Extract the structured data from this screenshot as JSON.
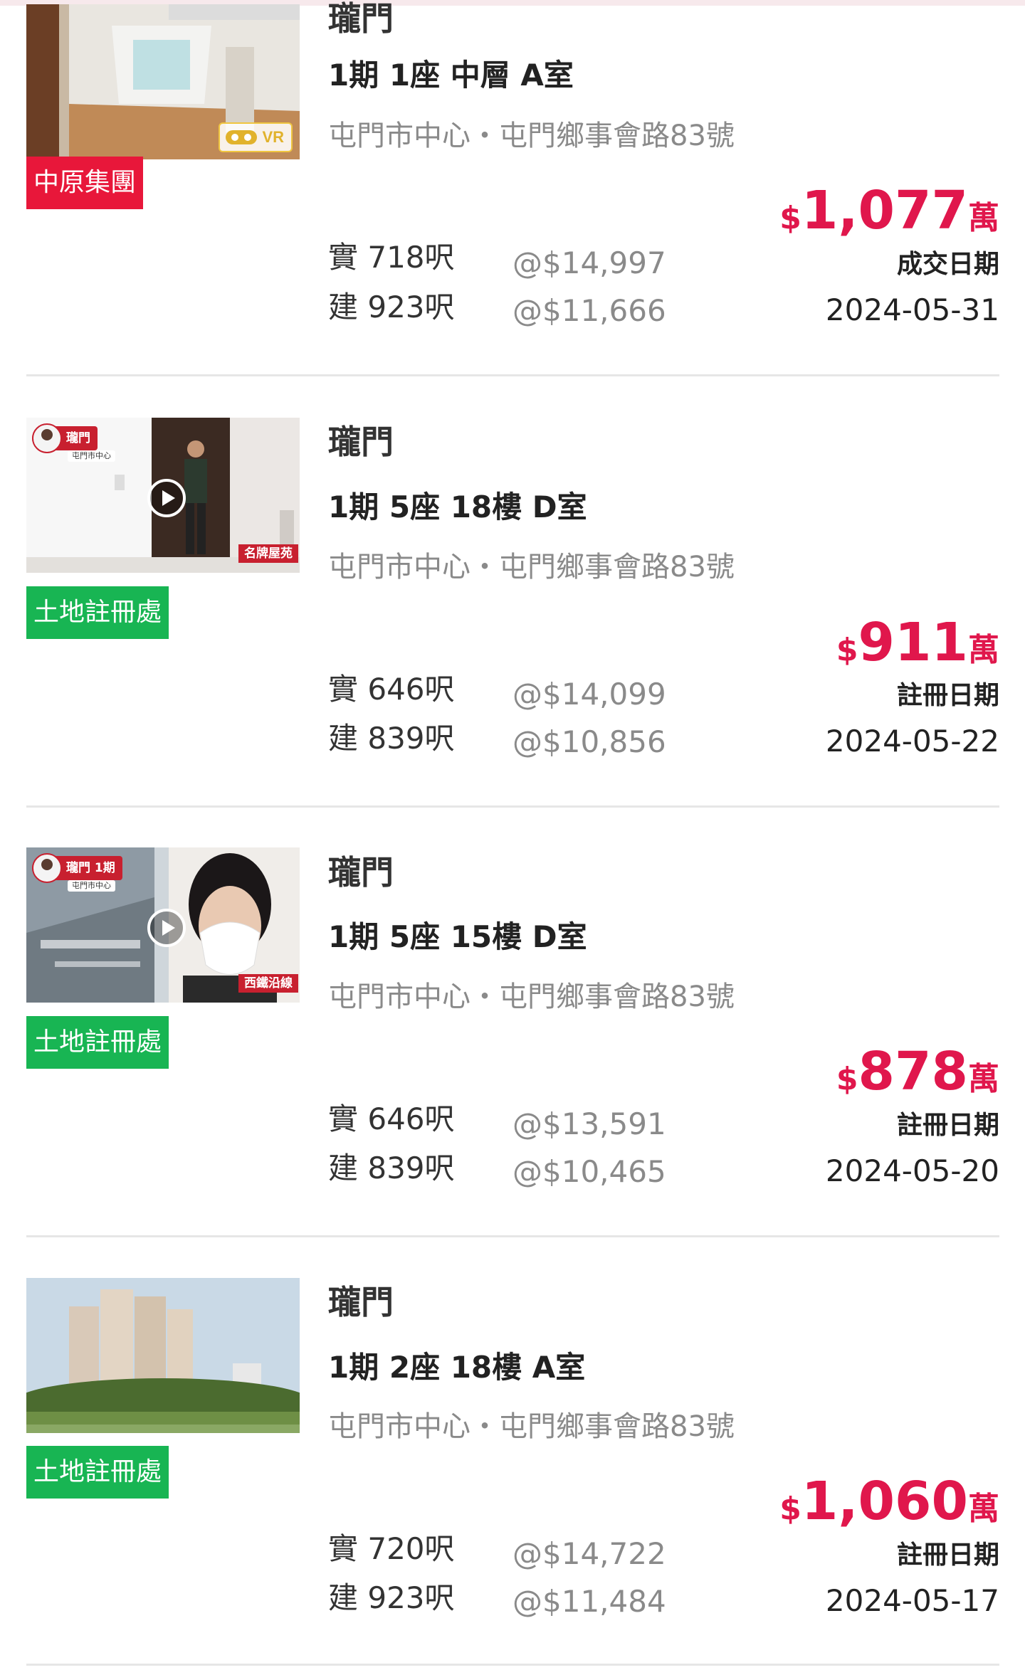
{
  "colors": {
    "price": "#e0174c",
    "centaline_badge": "#e8173a",
    "land_registry_badge": "#18b553",
    "divider": "#e6e6e6"
  },
  "listings": [
    {
      "estate": "瓏門",
      "unit": "1期 1座 中層 A室",
      "address": "屯門市中心・屯門鄉事會路83號",
      "source": "中原集團",
      "source_color": "#e8173a",
      "media": "VR",
      "media_icon": "vr-goggles-icon",
      "price_currency": "$",
      "price_amount": "1,077",
      "price_unit": "萬",
      "saleable_area": "實 718呎",
      "saleable_ppsf": "@$14,997",
      "gross_area": "建 923呎",
      "gross_ppsf": "@$11,666",
      "date_label": "成交日期",
      "date": "2024-05-31"
    },
    {
      "estate": "瓏門",
      "unit": "1期 5座 18樓 D室",
      "address": "屯門市中心・屯門鄉事會路83號",
      "source": "土地註冊處",
      "source_color": "#18b553",
      "media": "video",
      "media_icon": "play-icon",
      "overlay_badge": "瓏門",
      "overlay_badge_sub": "屯門市中心",
      "overlay_tag": "名牌屋苑",
      "price_currency": "$",
      "price_amount": "911",
      "price_unit": "萬",
      "saleable_area": "實 646呎",
      "saleable_ppsf": "@$14,099",
      "gross_area": "建 839呎",
      "gross_ppsf": "@$10,856",
      "date_label": "註冊日期",
      "date": "2024-05-22"
    },
    {
      "estate": "瓏門",
      "unit": "1期 5座 15樓 D室",
      "address": "屯門市中心・屯門鄉事會路83號",
      "source": "土地註冊處",
      "source_color": "#18b553",
      "media": "video",
      "media_icon": "play-icon",
      "overlay_badge": "瓏門 1期",
      "overlay_badge_sub": "屯門市中心",
      "overlay_tag": "西鐵沿線",
      "price_currency": "$",
      "price_amount": "878",
      "price_unit": "萬",
      "saleable_area": "實 646呎",
      "saleable_ppsf": "@$13,591",
      "gross_area": "建 839呎",
      "gross_ppsf": "@$10,465",
      "date_label": "註冊日期",
      "date": "2024-05-20"
    },
    {
      "estate": "瓏門",
      "unit": "1期 2座 18樓 A室",
      "address": "屯門市中心・屯門鄉事會路83號",
      "source": "土地註冊處",
      "source_color": "#18b553",
      "media": "photo",
      "price_currency": "$",
      "price_amount": "1,060",
      "price_unit": "萬",
      "saleable_area": "實 720呎",
      "saleable_ppsf": "@$14,722",
      "gross_area": "建 923呎",
      "gross_ppsf": "@$11,484",
      "date_label": "註冊日期",
      "date": "2024-05-17"
    }
  ]
}
